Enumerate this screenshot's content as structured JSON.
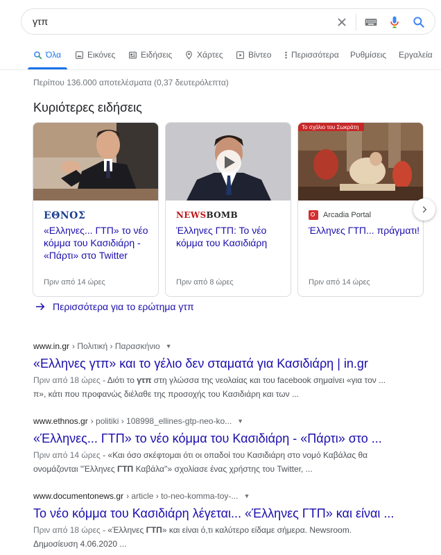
{
  "search": {
    "query": "γτπ"
  },
  "tabs": [
    {
      "label": "Όλα",
      "icon": "search-icon"
    },
    {
      "label": "Εικόνες",
      "icon": "image-icon"
    },
    {
      "label": "Ειδήσεις",
      "icon": "news-icon"
    },
    {
      "label": "Χάρτες",
      "icon": "map-pin-icon"
    },
    {
      "label": "Βίντεο",
      "icon": "video-icon"
    },
    {
      "label": "Περισσότερα",
      "icon": "more-vert-icon"
    },
    {
      "label": "Ρυθμίσεις"
    },
    {
      "label": "Εργαλεία"
    }
  ],
  "stats": "Περίπου 136.000 αποτελέσματα (0,37 δευτερόλεπτα)",
  "top_stories": {
    "title": "Κυριότερες ειδήσεις",
    "cards": [
      {
        "source": "ΕΘΝΟΣ",
        "headline": "«Ελληνες... ΓΤΠ» το νέο κόμμα του Κασιδιάρη - «Πάρτι» στο Twitter",
        "time": "Πριν από 14 ώρες"
      },
      {
        "source_a": "NEWS",
        "source_b": "BOMB",
        "headline": "Έλληνες ΓΤΠ: Το νέο κόμμα του Κασιδιάρη",
        "time": "Πριν από 8 ώρες"
      },
      {
        "source": "Arcadia Portal",
        "headline": "Έλληνες ΓΤΠ... πράγματι!",
        "time": "Πριν από 14 ώρες",
        "image_caption": "Το σχόλιο του Σωκράτη"
      }
    ],
    "more_label": "Περισσότερα για το ερώτημα γτπ"
  },
  "results": [
    {
      "domain": "www.in.gr",
      "path": "› Πολιτική › Παρασκήνιο",
      "title": "«Ελληνες γτπ» και το γέλιο δεν σταματά για Κασιδιάρη | in.gr",
      "date": "Πριν από 18 ώρες",
      "snippet_pre": " - Διότι το ",
      "snippet_bold": "γτπ",
      "snippet_post": " στη γλώσσα της νεολαίας και του facebook σημαίνει «για τον ...",
      "snippet_line2": "π», κάτι που προφανώς διέλαθε της προσοχής του Κασιδιάρη και των ..."
    },
    {
      "domain": "www.ethnos.gr",
      "path": "› politiki › 108998_ellines-gtp-neo-ko...",
      "title": "«Έλληνες... ΓΤΠ» το νέο κόμμα του Κασιδιάρη - «Πάρτι» στο ...",
      "date": "Πριν από 14 ώρες",
      "snippet_pre": " - «Και όσο σκέφτομαι ότι οι οπαδοί του Κασιδιάρη στο νομό Καβάλας θα",
      "snippet_line2_pre": "ονομάζονται ''Έλληνες ",
      "snippet_bold": "ΓΤΠ",
      "snippet_line2_post": " Καβάλα''» σχολίασε ένας χρήστης του Twitter, ..."
    },
    {
      "domain": "www.documentonews.gr",
      "path": "› article › to-neo-komma-toy-...",
      "title": "Το νέο κόμμα του Κασιδιάρη λέγεται... «Έλληνες ΓΤΠ» και είναι ...",
      "date": "Πριν από 18 ώρες",
      "snippet_pre": " - «Έλληνες ",
      "snippet_bold": "ΓΤΠ",
      "snippet_post": "» και είναι ό,τι καλύτερο είδαμε σήμερα. Newsroom.",
      "snippet_line2": "Δημοσίευση 4.06.2020 ..."
    }
  ]
}
